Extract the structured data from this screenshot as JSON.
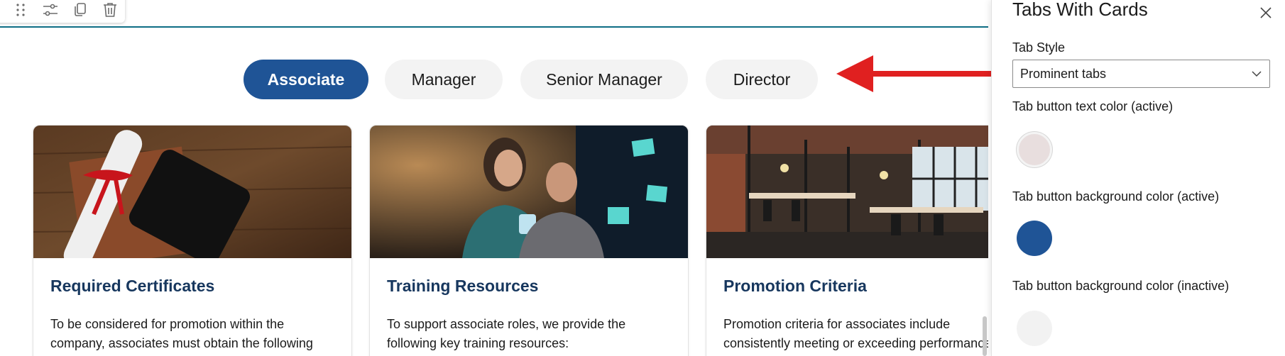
{
  "toolbar": {
    "icons": [
      "drag-handle-icon",
      "settings-sliders-icon",
      "duplicate-icon",
      "delete-icon"
    ]
  },
  "tabs": [
    {
      "label": "Associate",
      "active": true
    },
    {
      "label": "Manager",
      "active": false
    },
    {
      "label": "Senior Manager",
      "active": false
    },
    {
      "label": "Director",
      "active": false
    }
  ],
  "cards": [
    {
      "title": "Required Certificates",
      "text": "To be considered for promotion within the company, associates must obtain the following",
      "image": "diploma-scroll-with-red-ribbon"
    },
    {
      "title": "Training Resources",
      "text": "To support associate roles, we provide the following key training resources:",
      "image": "two-colleagues-at-monitor"
    },
    {
      "title": "Promotion Criteria",
      "text": "Promotion criteria for associates include consistently meeting or exceeding performance",
      "image": "industrial-open-office"
    }
  ],
  "panel": {
    "title": "Tabs With Cards",
    "tab_style_label": "Tab Style",
    "tab_style_value": "Prominent tabs",
    "text_color_active_label": "Tab button text color (active)",
    "bg_color_active_label": "Tab button background color (active)",
    "bg_color_inactive_label": "Tab button background color (inactive)"
  },
  "colors": {
    "accent": "#1f5496",
    "card_title": "#17375e",
    "section_line": "#0e6e85",
    "inactive_tab": "#f3f3f3",
    "text_color_active": "#e8dede",
    "bg_color_active": "#1f5496",
    "bg_color_inactive": "#f2f2f2",
    "arrow": "#e02020"
  }
}
